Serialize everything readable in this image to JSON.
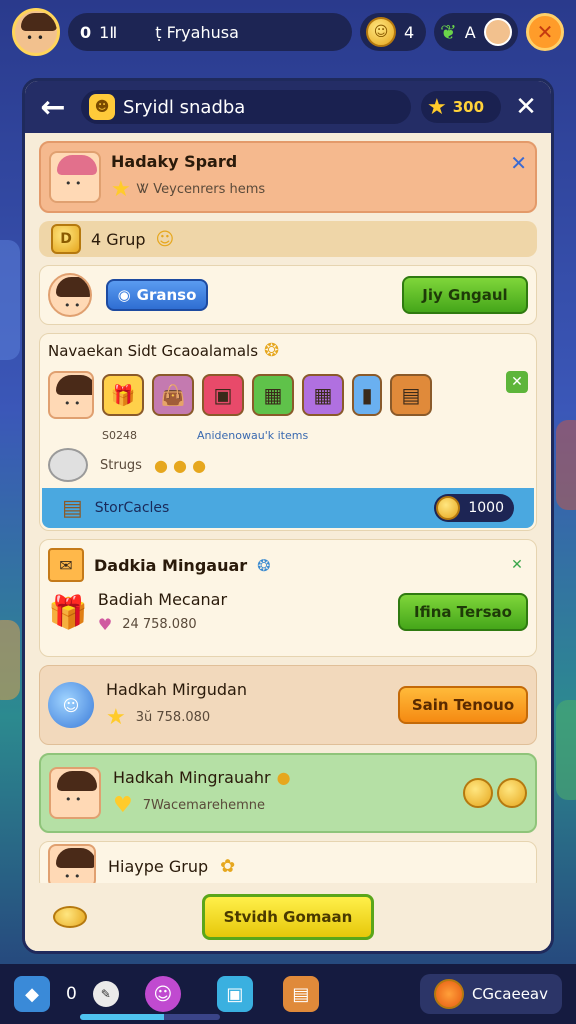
{
  "topbar": {
    "level": "0",
    "level_code": "1Ⅱ",
    "player_name": "ṭ Fryahusa",
    "coins": "4",
    "gems": "A"
  },
  "panel": {
    "title": "Sryidl snadba",
    "score": "300"
  },
  "cards": {
    "featured": {
      "name": "Hadaky Spard",
      "sub": "Ꮤ Veycenrers hems"
    },
    "group_header": {
      "label": "4 Grup"
    },
    "group_row": {
      "tag": "Granso",
      "button": "Jiy Gngaul"
    },
    "inventory": {
      "title": "Navaekan Sidt Gcaoalamals",
      "count_label": "S0248",
      "desc_label": "Anidenowau'k items",
      "strings_label": "Strugs",
      "bar_label": "StorCacles",
      "bar_value": "1000"
    },
    "mission1": {
      "title": "Dadkia Mingauar",
      "name": "Badiah Mecanar",
      "value": "24 758.080",
      "button": "Ifina Tersao"
    },
    "mission2": {
      "name": "Hadkah Mirgudan",
      "value": "3ŭ 758.080",
      "button": "Sain Tenouo"
    },
    "mission3": {
      "name": "Hadkah Mingrauahr",
      "sub": "7Wacemarehemne"
    },
    "mission4": {
      "name": "Hiaype Grup"
    }
  },
  "main_button": "Stvidh Gomaan",
  "bottom": {
    "count": "0",
    "chest_label": "CGcaeeav"
  },
  "colors": {
    "accent": "#242d66",
    "panel": "#f7ecd8",
    "green": "#5db53a",
    "orange": "#f58a12"
  }
}
